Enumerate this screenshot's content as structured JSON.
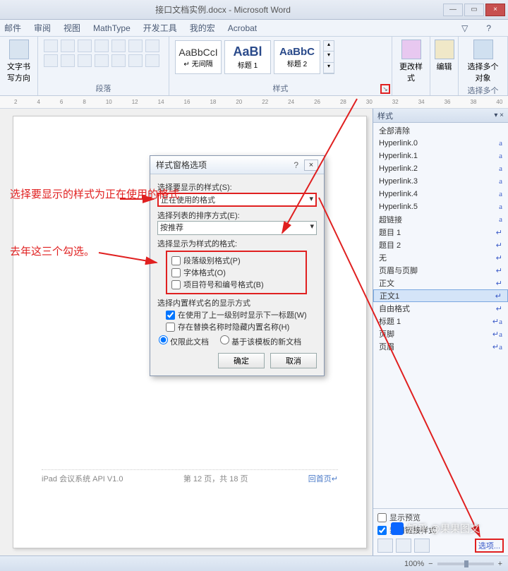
{
  "window": {
    "title": "接口文档实例.docx - Microsoft Word",
    "min": "—",
    "max": "▭",
    "close": "×"
  },
  "menu": {
    "items": [
      "邮件",
      "审阅",
      "视图",
      "MathType",
      "开发工具",
      "我的宏",
      "Acrobat"
    ],
    "expand": "▽",
    "help": "?"
  },
  "ribbon": {
    "orientation": {
      "label": "文字书写方向",
      "drop": "▾"
    },
    "paragraph_label": "段落",
    "styles_label": "样式",
    "select_label": "选择多个对象",
    "gallery": [
      {
        "preview": "AaBbCcI",
        "name": "↵ 无间隔"
      },
      {
        "preview": "AaBl",
        "name": "标题 1"
      },
      {
        "preview": "AaBbC",
        "name": "标题 2"
      }
    ],
    "change_styles": "更改样式",
    "edit": "编辑",
    "select": "选择多个对象"
  },
  "dialog": {
    "title": "样式窗格选项",
    "lbl_show": "选择要显示的样式(S):",
    "val_show": "正在使用的格式",
    "lbl_sort": "选择列表的排序方式(E):",
    "val_sort": "按推荐",
    "lbl_asstyle": "选择显示为样式的格式:",
    "chk1": "段落级别格式(P)",
    "chk2": "字体格式(O)",
    "chk3": "项目符号和编号格式(B)",
    "lbl_builtin": "选择内置样式名的显示方式",
    "chk4": "在使用了上一级别时显示下一标题(W)",
    "chk5": "存在替换名称时隐藏内置名称(H)",
    "radio1": "仅限此文档",
    "radio2": "基于该模板的新文档",
    "ok": "确定",
    "cancel": "取消"
  },
  "stylespane": {
    "title": "样式",
    "pin": "▾ ×",
    "items": [
      {
        "name": "全部清除",
        "mark": ""
      },
      {
        "name": "Hyperlink.0",
        "mark": "a"
      },
      {
        "name": "Hyperlink.1",
        "mark": "a"
      },
      {
        "name": "Hyperlink.2",
        "mark": "a"
      },
      {
        "name": "Hyperlink.3",
        "mark": "a"
      },
      {
        "name": "Hyperlink.4",
        "mark": "a"
      },
      {
        "name": "Hyperlink.5",
        "mark": "a"
      },
      {
        "name": "超链接",
        "mark": "a"
      },
      {
        "name": "题目 1",
        "mark": "↵"
      },
      {
        "name": "题目 2",
        "mark": "↵"
      },
      {
        "name": "无",
        "mark": "↵"
      },
      {
        "name": "页眉与页脚",
        "mark": "↵"
      },
      {
        "name": "正文",
        "mark": "↵"
      },
      {
        "name": "正文1",
        "mark": "↵",
        "sel": true
      },
      {
        "name": "自由格式",
        "mark": "↵"
      },
      {
        "name": "标题 1",
        "mark": "↵a"
      },
      {
        "name": "页脚",
        "mark": "↵a"
      },
      {
        "name": "页眉",
        "mark": "↵a"
      }
    ],
    "show_preview": "显示预览",
    "disable_linked": "禁用链接样式",
    "options": "选项..."
  },
  "page": {
    "footer_left": "iPad 会议系统 API  V1.0",
    "footer_center": "第 12 页，共 18 页",
    "footer_link": "回首页↵"
  },
  "annot": {
    "a1": "选择要显示的样式为正在使用的格式",
    "a2": "去年这三个勾选。"
  },
  "status": {
    "zoom": "100%",
    "minus": "−",
    "plus": "+"
  },
  "watermark": "知乎 @果果图文"
}
